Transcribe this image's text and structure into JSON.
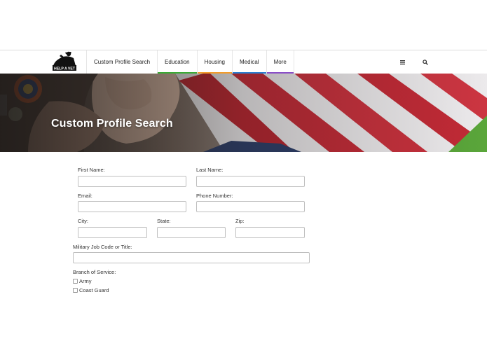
{
  "logo": {
    "text": "HELP A VET"
  },
  "nav": {
    "items": [
      {
        "label": "Custom Profile Search",
        "accent": ""
      },
      {
        "label": "Education",
        "accent": "#3aaa35"
      },
      {
        "label": "Housing",
        "accent": "#f39c2b"
      },
      {
        "label": "Medical",
        "accent": "#2b7fd0"
      },
      {
        "label": "More",
        "accent": "#8a4fc7"
      }
    ],
    "menu_icon": "hamburger-menu-icon",
    "search_icon": "search-icon"
  },
  "hero": {
    "title": "Custom Profile Search"
  },
  "form": {
    "first_name_label": "First Name:",
    "last_name_label": "Last Name:",
    "email_label": "Email:",
    "phone_label": "Phone Number:",
    "city_label": "City:",
    "state_label": "State:",
    "zip_label": "Zip:",
    "job_label": "Military Job Code or Title:",
    "branch_label": "Branch of Service:",
    "branches": [
      "Army",
      "Coast Guard"
    ]
  }
}
